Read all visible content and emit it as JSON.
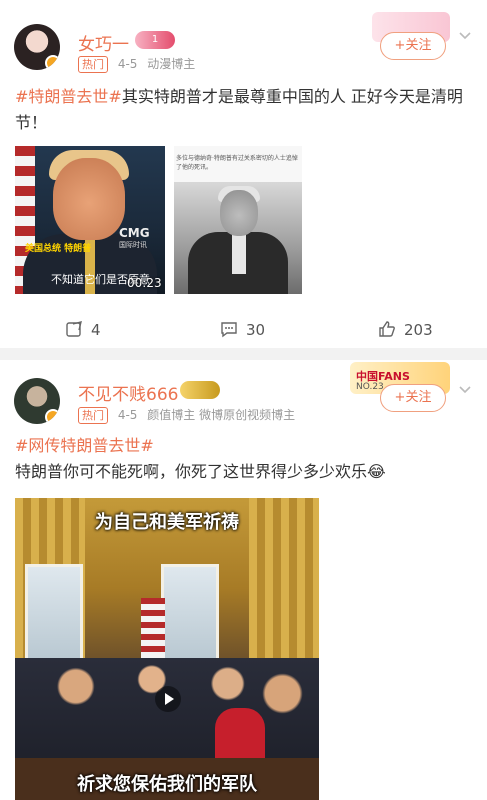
{
  "posts": [
    {
      "username": "女巧一",
      "level_badge": "1",
      "decor_text": "",
      "decor_sub": "",
      "hot_label": "热门",
      "date": "4-5",
      "tags": "动漫博主",
      "follow_label": "+关注",
      "topic": "#特朗普去世#",
      "body": "其实特朗普才是最尊重中国的人 正好今天是清明节！",
      "image1": {
        "caption_name": "美国总统 特朗普",
        "logo": "CMG",
        "logo_sub": "国际时讯",
        "subtitle": "不知道它们是否原意",
        "duration": "00:23"
      },
      "image2": {
        "caption": "多位与德纳奇·特朗普有过关系密切的人士追悼了他的死讯。"
      },
      "reposts": "4",
      "comments": "30",
      "likes": "203"
    },
    {
      "username": "不见不贱666",
      "level_badge": "",
      "decor_text": "中国FANS",
      "decor_sub": "NO.23",
      "hot_label": "热门",
      "date": "4-5",
      "tags": "颜值博主 微博原创视频博主",
      "follow_label": "+关注",
      "topic": "#网传特朗普去世#",
      "body": "特朗普你可不能死啊，你死了这世界得少多少欢乐😂",
      "video": {
        "top_caption": "为自己和美军祈祷",
        "bottom_caption": "祈求您保佑我们的军队"
      }
    }
  ],
  "colors": {
    "accent": "#eb7350",
    "divider": "#f2f2f2"
  },
  "icons": [
    "chevron-down-icon",
    "repost-icon",
    "comment-icon",
    "like-icon",
    "verified-badge-icon",
    "play-icon"
  ]
}
